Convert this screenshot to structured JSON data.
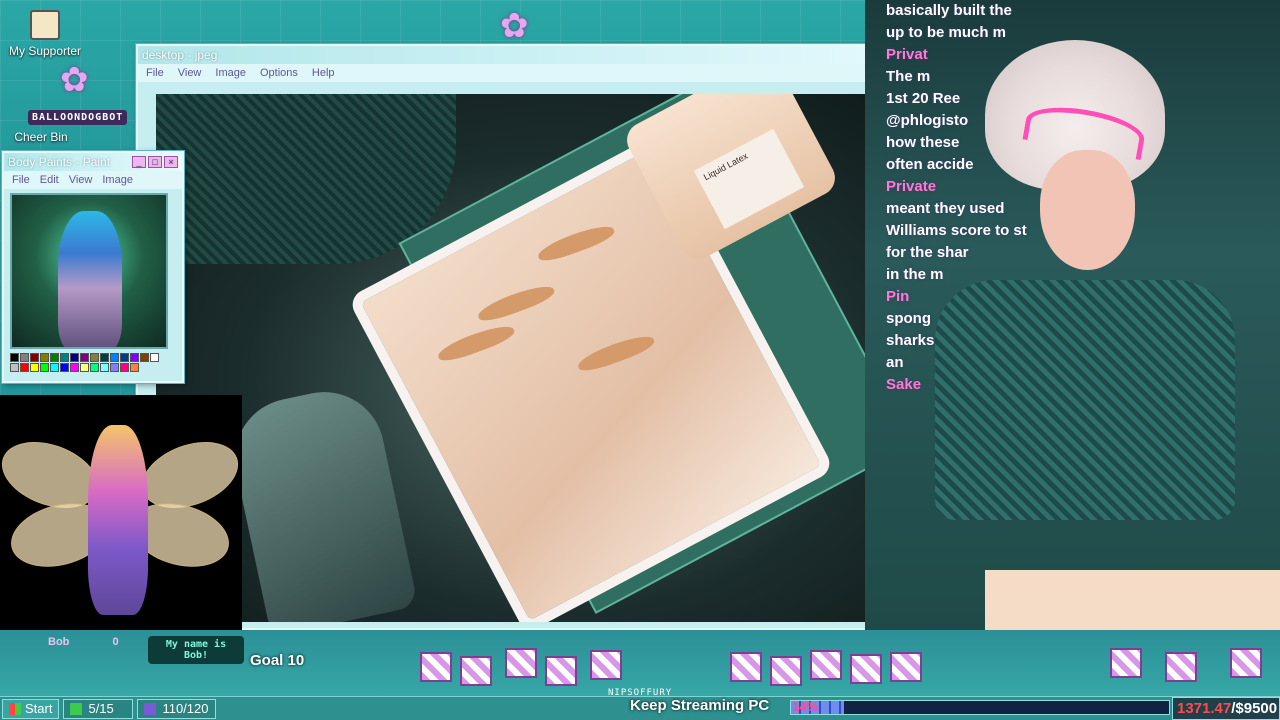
{
  "desktop": {
    "icons": [
      {
        "label": "My Supporter"
      },
      {
        "label": "Cheer Bin"
      }
    ],
    "bot_name": "BALLOONDOGBOT"
  },
  "main_window": {
    "title": "desktop - jpeg",
    "menu": [
      "File",
      "View",
      "Image",
      "Options",
      "Help"
    ],
    "bottle_brand": "Liquid Latex"
  },
  "paint_window": {
    "title": "Body Paints - Paint",
    "menu": [
      "File",
      "Edit",
      "View",
      "Image"
    ],
    "palette": [
      "#000000",
      "#808080",
      "#800000",
      "#808000",
      "#008000",
      "#008080",
      "#000080",
      "#800080",
      "#808040",
      "#004040",
      "#0080ff",
      "#004080",
      "#8000ff",
      "#804000",
      "#ffffff",
      "#c0c0c0",
      "#ff0000",
      "#ffff00",
      "#00ff00",
      "#00ffff",
      "#0000ff",
      "#ff00ff",
      "#ffff80",
      "#00ff80",
      "#80ffff",
      "#8080ff",
      "#ff0080",
      "#ff8040"
    ]
  },
  "chat": {
    "lines": [
      {
        "text": "basically built the",
        "style": "normal"
      },
      {
        "text": "up to be much m",
        "style": "normal"
      },
      {
        "text": "Privat",
        "style": "pink"
      },
      {
        "text": "The m",
        "style": "normal"
      },
      {
        "text": "1st 20 Ree",
        "style": "badge"
      },
      {
        "text": "@phlogisto",
        "style": "normal"
      },
      {
        "text": "how these",
        "style": "normal"
      },
      {
        "text": "often accide",
        "style": "normal"
      },
      {
        "text": "Private",
        "style": "pink"
      },
      {
        "text": "meant they used",
        "style": "normal"
      },
      {
        "text": "Williams score to st",
        "style": "normal"
      },
      {
        "text": "for the shar",
        "style": "normal"
      },
      {
        "text": "in the m",
        "style": "normal"
      },
      {
        "text": "Pin",
        "style": "pink"
      },
      {
        "text": "spong",
        "style": "normal"
      },
      {
        "text": "sharks",
        "style": "normal"
      },
      {
        "text": "",
        "style": "normal"
      },
      {
        "text": "",
        "style": "normal"
      },
      {
        "text": "an",
        "style": "normal"
      },
      {
        "text": "Sake",
        "style": "pink"
      }
    ]
  },
  "overlay": {
    "bob_label": "Bob",
    "bob_level": "0",
    "bob_bubble": "My name is Bob!",
    "goal_text": "Goal 10",
    "handle": "NIPSOFFURY",
    "stream_label": "Keep Streaming PC",
    "stream_progress_pct": "14%",
    "stream_progress_value": 0.14
  },
  "taskbar": {
    "start": "Start",
    "item1": "5/15",
    "item2": "110/120",
    "money_current": "1371.47",
    "money_total": "/$9500"
  },
  "colors": {
    "accent_pink": "#ff7ad1",
    "teal_bg": "#2aa7a6",
    "window_chrome": "#c6eef0"
  }
}
